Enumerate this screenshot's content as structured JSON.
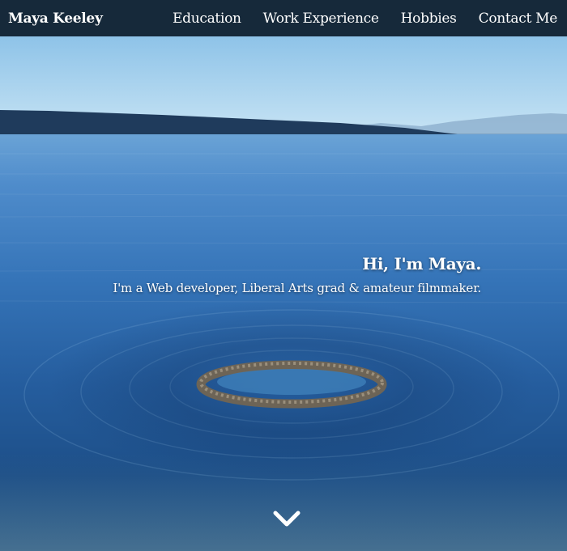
{
  "navbar": {
    "brand": "Maya Keeley",
    "links": [
      {
        "label": "Education"
      },
      {
        "label": "Work Experience"
      },
      {
        "label": "Hobbies"
      },
      {
        "label": "Contact Me"
      }
    ]
  },
  "intro": {
    "heading": "Hi, I'm Maya.",
    "subheading": "I'm a Web developer, Liberal Arts grad & amateur filmmaker."
  },
  "scroll_button": {
    "icon": "chevron-down-icon"
  },
  "colors": {
    "navbar_bg": "#16293a",
    "text": "#ffffff",
    "sky": "#a9d3ee",
    "water_far": "#5f97cf",
    "water_deep": "#173f73"
  }
}
